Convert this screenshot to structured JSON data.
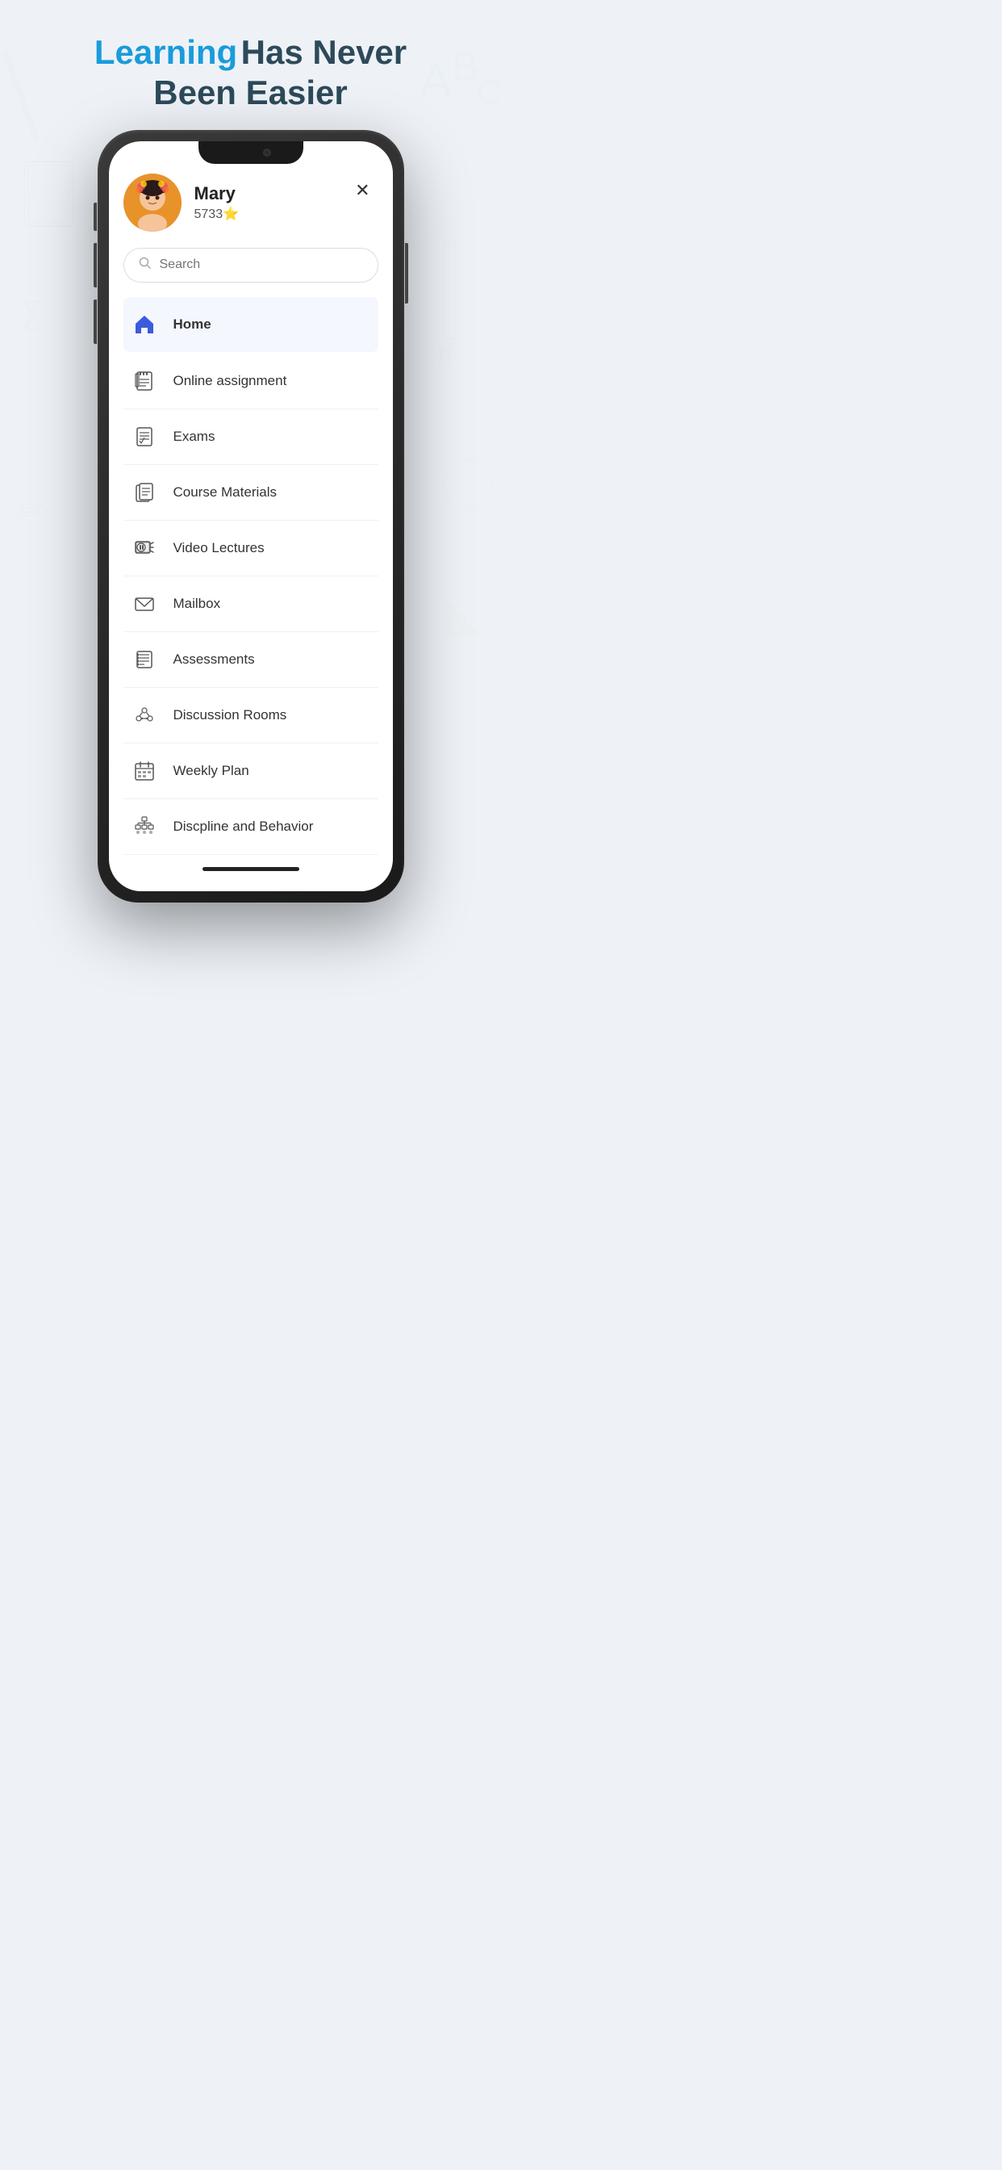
{
  "page": {
    "background_color": "#eef2f7"
  },
  "header": {
    "word1": "Learning",
    "word2": "Has Never",
    "word3": "Been Easier"
  },
  "user": {
    "name": "Mary",
    "points": "5733",
    "star": "⭐"
  },
  "search": {
    "placeholder": "Search"
  },
  "close_button": "✕",
  "menu": {
    "items": [
      {
        "id": "home",
        "label": "Home",
        "icon": "home"
      },
      {
        "id": "online-assignment",
        "label": "Online assignment",
        "icon": "assignment"
      },
      {
        "id": "exams",
        "label": "Exams",
        "icon": "exams"
      },
      {
        "id": "course-materials",
        "label": "Course Materials",
        "icon": "materials"
      },
      {
        "id": "video-lectures",
        "label": "Video Lectures",
        "icon": "video"
      },
      {
        "id": "mailbox",
        "label": "Mailbox",
        "icon": "mail"
      },
      {
        "id": "assessments",
        "label": "Assessments",
        "icon": "assessments"
      },
      {
        "id": "discussion-rooms",
        "label": "Discussion Rooms",
        "icon": "discussion"
      },
      {
        "id": "weekly-plan",
        "label": "Weekly Plan",
        "icon": "calendar"
      },
      {
        "id": "discipline-behavior",
        "label": "Discpline and Behavior",
        "icon": "discipline"
      }
    ]
  }
}
